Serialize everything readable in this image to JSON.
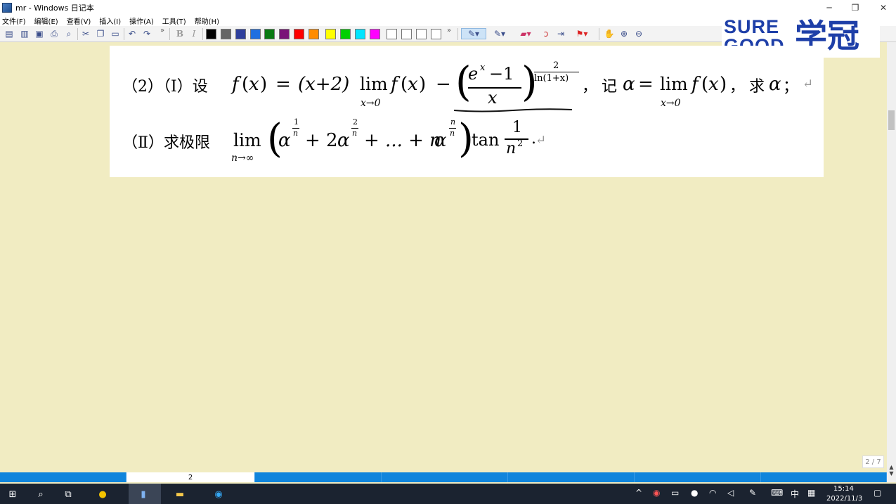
{
  "window": {
    "title": "mr - Windows 日记本",
    "minimize": "─",
    "maximize": "❐",
    "close": "✕"
  },
  "menu": [
    "文件(F)",
    "编辑(E)",
    "查看(V)",
    "插入(I)",
    "操作(A)",
    "工具(T)",
    "帮助(H)"
  ],
  "toolbar": {
    "more": "»",
    "bold": "B",
    "italic": "I",
    "colors": [
      "#000000",
      "#666666",
      "#2e3f9c",
      "#1f6fe0",
      "#0a7a12",
      "#7a1478",
      "#ff0000",
      "#ff8c00",
      "#ffff00",
      "#00d000",
      "#00e5ff",
      "#ff00ff",
      "#ffffff",
      "#ffffff",
      "#ffffff",
      "#ffffff"
    ]
  },
  "logo": {
    "line1": "SURE",
    "line2": "GOOD",
    "cn": "学冠"
  },
  "document": {
    "line1": {
      "label": "（2）（Ⅰ）设",
      "f": "f",
      "lp": "(",
      "x": "x",
      "rp": ")",
      "eq": "=",
      "xplus2": "(x+2)",
      "lim": "lim",
      "lim_sub": "x→0",
      "minus": "−",
      "frac_num": "−1",
      "frac_e": "e",
      "frac_ex": "x",
      "frac_den": "x",
      "exp_num": "2",
      "exp_den": "ln(1+x)",
      "comma": "，",
      "ji": "记",
      "alpha": "α",
      "qiu": "求",
      "semi": "；",
      "ret": "↵"
    },
    "line2": {
      "label": "（Ⅱ）求极限",
      "lim": "lim",
      "lim_sub": "n→∞",
      "a1": "α",
      "e1n": "1",
      "e1d": "n",
      "p2": "+ 2",
      "e2n": "2",
      "e2d": "n",
      "dots": "+ ... + n",
      "e3n": "n",
      "e3d": "n",
      "tan": "tan",
      "fn": "1",
      "fd": "n",
      "fd_exp": "2",
      "period": ".",
      "ret": "↵"
    }
  },
  "page_indicator": "2 / 7",
  "tabs": [
    "",
    "2",
    "",
    "",
    "",
    "",
    "",
    ""
  ],
  "tray": {
    "input_method": "中",
    "time": "15:14",
    "date": "2022/11/3"
  }
}
